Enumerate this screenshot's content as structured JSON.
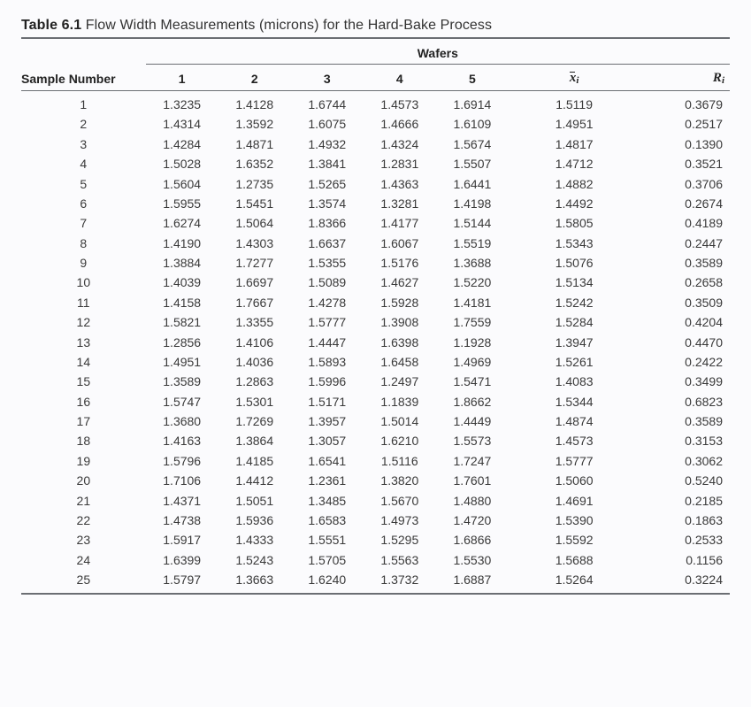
{
  "caption": {
    "label": "Table 6.1",
    "title": "Flow Width Measurements (microns) for the Hard-Bake Process"
  },
  "header": {
    "spanner": "Wafers",
    "sample_number": "Sample Number",
    "wafer_cols": [
      "1",
      "2",
      "3",
      "4",
      "5"
    ],
    "xbar_letter": "x",
    "xbar_sub": "i",
    "r_letter": "R",
    "r_sub": "i"
  },
  "chart_data": {
    "type": "table",
    "columns": [
      "Sample Number",
      "1",
      "2",
      "3",
      "4",
      "5",
      "x̄_i",
      "R_i"
    ],
    "rows": [
      {
        "n": "1",
        "w": [
          "1.3235",
          "1.4128",
          "1.6744",
          "1.4573",
          "1.6914"
        ],
        "x": "1.5119",
        "r": "0.3679"
      },
      {
        "n": "2",
        "w": [
          "1.4314",
          "1.3592",
          "1.6075",
          "1.4666",
          "1.6109"
        ],
        "x": "1.4951",
        "r": "0.2517"
      },
      {
        "n": "3",
        "w": [
          "1.4284",
          "1.4871",
          "1.4932",
          "1.4324",
          "1.5674"
        ],
        "x": "1.4817",
        "r": "0.1390"
      },
      {
        "n": "4",
        "w": [
          "1.5028",
          "1.6352",
          "1.3841",
          "1.2831",
          "1.5507"
        ],
        "x": "1.4712",
        "r": "0.3521"
      },
      {
        "n": "5",
        "w": [
          "1.5604",
          "1.2735",
          "1.5265",
          "1.4363",
          "1.6441"
        ],
        "x": "1.4882",
        "r": "0.3706"
      },
      {
        "n": "6",
        "w": [
          "1.5955",
          "1.5451",
          "1.3574",
          "1.3281",
          "1.4198"
        ],
        "x": "1.4492",
        "r": "0.2674"
      },
      {
        "n": "7",
        "w": [
          "1.6274",
          "1.5064",
          "1.8366",
          "1.4177",
          "1.5144"
        ],
        "x": "1.5805",
        "r": "0.4189"
      },
      {
        "n": "8",
        "w": [
          "1.4190",
          "1.4303",
          "1.6637",
          "1.6067",
          "1.5519"
        ],
        "x": "1.5343",
        "r": "0.2447"
      },
      {
        "n": "9",
        "w": [
          "1.3884",
          "1.7277",
          "1.5355",
          "1.5176",
          "1.3688"
        ],
        "x": "1.5076",
        "r": "0.3589"
      },
      {
        "n": "10",
        "w": [
          "1.4039",
          "1.6697",
          "1.5089",
          "1.4627",
          "1.5220"
        ],
        "x": "1.5134",
        "r": "0.2658"
      },
      {
        "n": "11",
        "w": [
          "1.4158",
          "1.7667",
          "1.4278",
          "1.5928",
          "1.4181"
        ],
        "x": "1.5242",
        "r": "0.3509"
      },
      {
        "n": "12",
        "w": [
          "1.5821",
          "1.3355",
          "1.5777",
          "1.3908",
          "1.7559"
        ],
        "x": "1.5284",
        "r": "0.4204"
      },
      {
        "n": "13",
        "w": [
          "1.2856",
          "1.4106",
          "1.4447",
          "1.6398",
          "1.1928"
        ],
        "x": "1.3947",
        "r": "0.4470"
      },
      {
        "n": "14",
        "w": [
          "1.4951",
          "1.4036",
          "1.5893",
          "1.6458",
          "1.4969"
        ],
        "x": "1.5261",
        "r": "0.2422"
      },
      {
        "n": "15",
        "w": [
          "1.3589",
          "1.2863",
          "1.5996",
          "1.2497",
          "1.5471"
        ],
        "x": "1.4083",
        "r": "0.3499"
      },
      {
        "n": "16",
        "w": [
          "1.5747",
          "1.5301",
          "1.5171",
          "1.1839",
          "1.8662"
        ],
        "x": "1.5344",
        "r": "0.6823"
      },
      {
        "n": "17",
        "w": [
          "1.3680",
          "1.7269",
          "1.3957",
          "1.5014",
          "1.4449"
        ],
        "x": "1.4874",
        "r": "0.3589"
      },
      {
        "n": "18",
        "w": [
          "1.4163",
          "1.3864",
          "1.3057",
          "1.6210",
          "1.5573"
        ],
        "x": "1.4573",
        "r": "0.3153"
      },
      {
        "n": "19",
        "w": [
          "1.5796",
          "1.4185",
          "1.6541",
          "1.5116",
          "1.7247"
        ],
        "x": "1.5777",
        "r": "0.3062"
      },
      {
        "n": "20",
        "w": [
          "1.7106",
          "1.4412",
          "1.2361",
          "1.3820",
          "1.7601"
        ],
        "x": "1.5060",
        "r": "0.5240"
      },
      {
        "n": "21",
        "w": [
          "1.4371",
          "1.5051",
          "1.3485",
          "1.5670",
          "1.4880"
        ],
        "x": "1.4691",
        "r": "0.2185"
      },
      {
        "n": "22",
        "w": [
          "1.4738",
          "1.5936",
          "1.6583",
          "1.4973",
          "1.4720"
        ],
        "x": "1.5390",
        "r": "0.1863"
      },
      {
        "n": "23",
        "w": [
          "1.5917",
          "1.4333",
          "1.5551",
          "1.5295",
          "1.6866"
        ],
        "x": "1.5592",
        "r": "0.2533"
      },
      {
        "n": "24",
        "w": [
          "1.6399",
          "1.5243",
          "1.5705",
          "1.5563",
          "1.5530"
        ],
        "x": "1.5688",
        "r": "0.1156"
      },
      {
        "n": "25",
        "w": [
          "1.5797",
          "1.3663",
          "1.6240",
          "1.3732",
          "1.6887"
        ],
        "x": "1.5264",
        "r": "0.3224"
      }
    ]
  }
}
